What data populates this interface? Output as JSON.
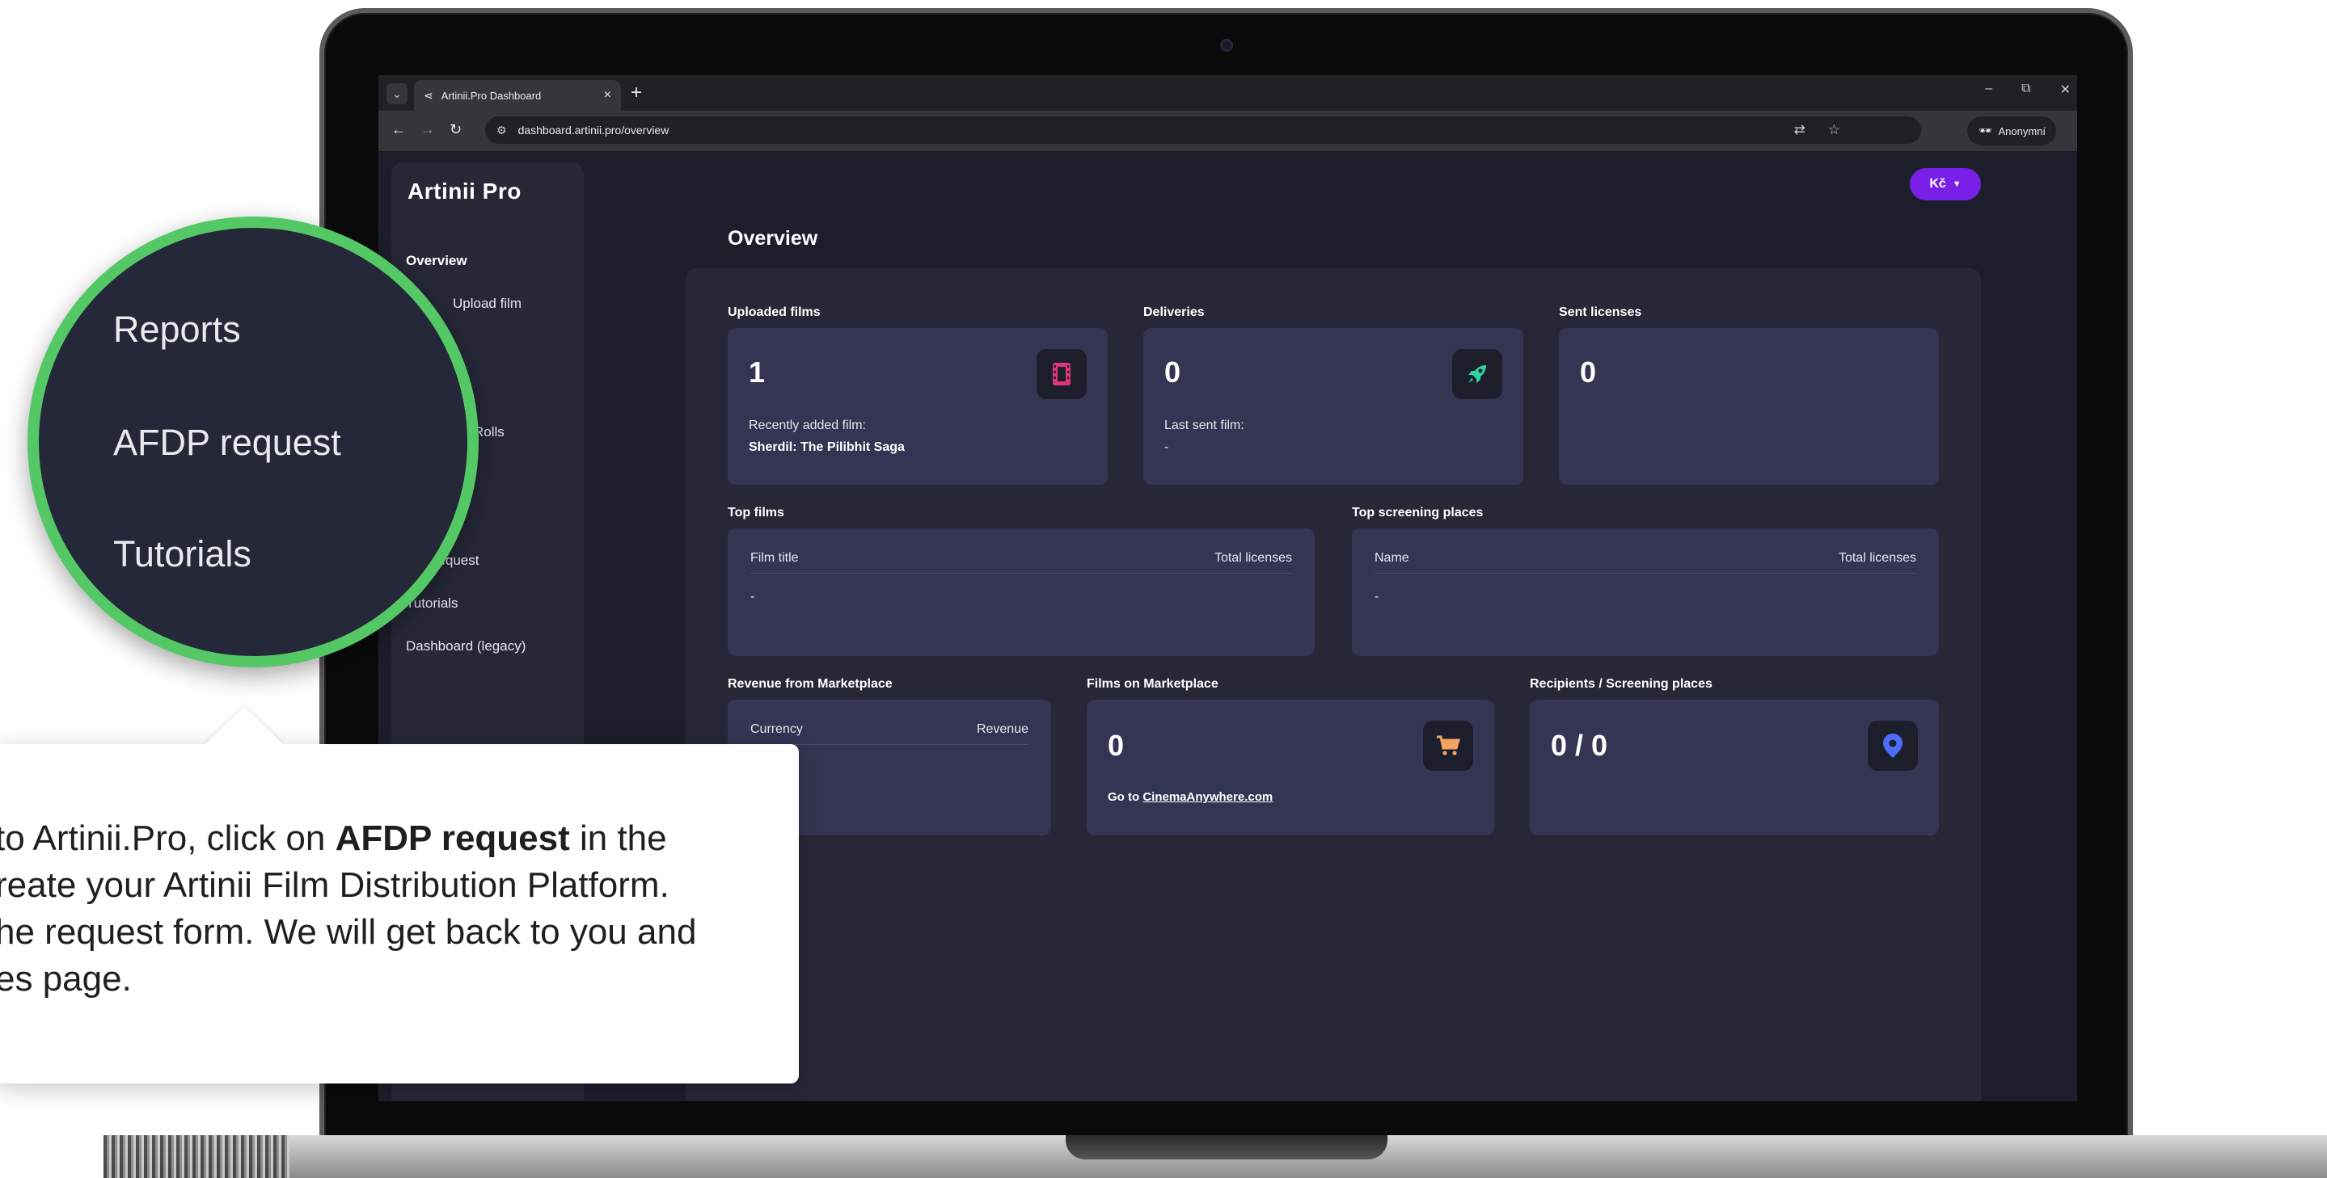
{
  "browser": {
    "tab_title": "Artinii.Pro Dashboard",
    "url": "dashboard.artinii.pro/overview",
    "profile_label": "Anonymní"
  },
  "app": {
    "logo": "Artinii Pro",
    "currency_button": "Kč"
  },
  "sidebar": {
    "items": [
      {
        "label": "Overview",
        "active": true
      },
      {
        "label": "Upload film"
      },
      {
        "label": ""
      },
      {
        "label": ""
      },
      {
        "label": "Rolls"
      },
      {
        "label": "s"
      },
      {
        "label": ""
      },
      {
        "label": "P request"
      },
      {
        "label": "Tutorials"
      },
      {
        "label": "Dashboard (legacy)"
      }
    ]
  },
  "overview": {
    "title": "Overview",
    "uploaded_films": {
      "label": "Uploaded films",
      "value": "1",
      "sub_label": "Recently added film:",
      "sub_value": "Sherdil: The Pilibhit Saga"
    },
    "deliveries": {
      "label": "Deliveries",
      "value": "0",
      "sub_label": "Last sent film:",
      "sub_value": "-"
    },
    "sent_licenses": {
      "label": "Sent licenses",
      "value": "0"
    },
    "top_films": {
      "label": "Top films",
      "col1": "Film title",
      "col2": "Total licenses",
      "empty": "-"
    },
    "top_screening": {
      "label": "Top screening places",
      "col1": "Name",
      "col2": "Total licenses",
      "empty": "-"
    },
    "revenue": {
      "label": "Revenue from Marketplace",
      "col1": "Currency",
      "col2": "Revenue"
    },
    "films_marketplace": {
      "label": "Films on Marketplace",
      "value": "0",
      "link_prefix": "Go to ",
      "link": "CinemaAnywhere.com"
    },
    "recipients": {
      "label": "Recipients / Screening places",
      "value": "0 / 0"
    }
  },
  "magnifier": {
    "items": [
      "Reports",
      "AFDP request",
      "Tutorials"
    ]
  },
  "callout": {
    "line1_pre": "to Artinii.Pro, click on ",
    "line1_bold": "AFDP request",
    "line1_post": " in the",
    "line2": "reate your Artinii Film Distribution Platform.",
    "line3": "he request form. We will get back to you and",
    "line4": "es page."
  },
  "colors": {
    "accent_purple": "#7a1fe8",
    "highlight_green": "#55c866",
    "film_icon": "#e0357a",
    "rocket_icon": "#2ed3a0",
    "cart_icon": "#f3a462",
    "pin_icon": "#4d6cf5"
  }
}
